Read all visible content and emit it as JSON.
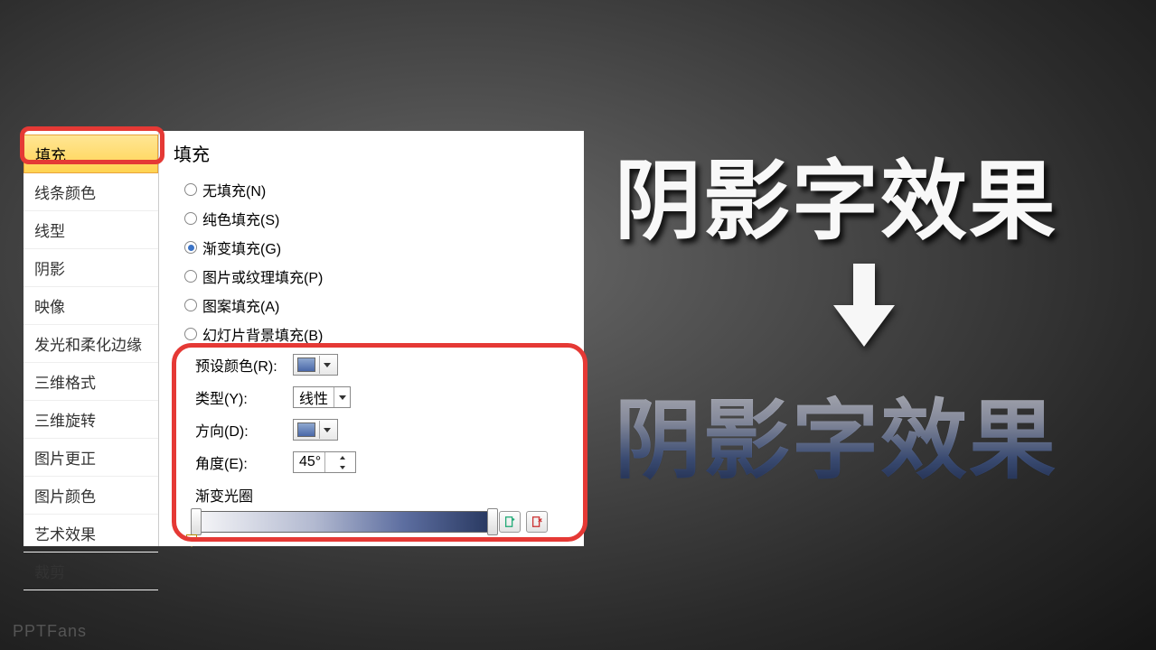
{
  "sidebar": {
    "items": [
      "填充",
      "线条颜色",
      "线型",
      "阴影",
      "映像",
      "发光和柔化边缘",
      "三维格式",
      "三维旋转",
      "图片更正",
      "图片颜色",
      "艺术效果",
      "裁剪"
    ],
    "active_index": 0
  },
  "panel": {
    "title": "填充",
    "radios": [
      {
        "label": "无填充(N)",
        "selected": false
      },
      {
        "label": "纯色填充(S)",
        "selected": false
      },
      {
        "label": "渐变填充(G)",
        "selected": true
      },
      {
        "label": "图片或纹理填充(P)",
        "selected": false
      },
      {
        "label": "图案填充(A)",
        "selected": false
      },
      {
        "label": "幻灯片背景填充(B)",
        "selected": false
      }
    ],
    "preset_label": "预设颜色(R):",
    "type_label": "类型(Y):",
    "type_value": "线性",
    "direction_label": "方向(D):",
    "angle_label": "角度(E):",
    "angle_value": "45°",
    "grad_label": "渐变光圈"
  },
  "demo": {
    "top_text": "阴影字效果",
    "bottom_text": "阴影字效果"
  },
  "watermark": "PPTFans"
}
